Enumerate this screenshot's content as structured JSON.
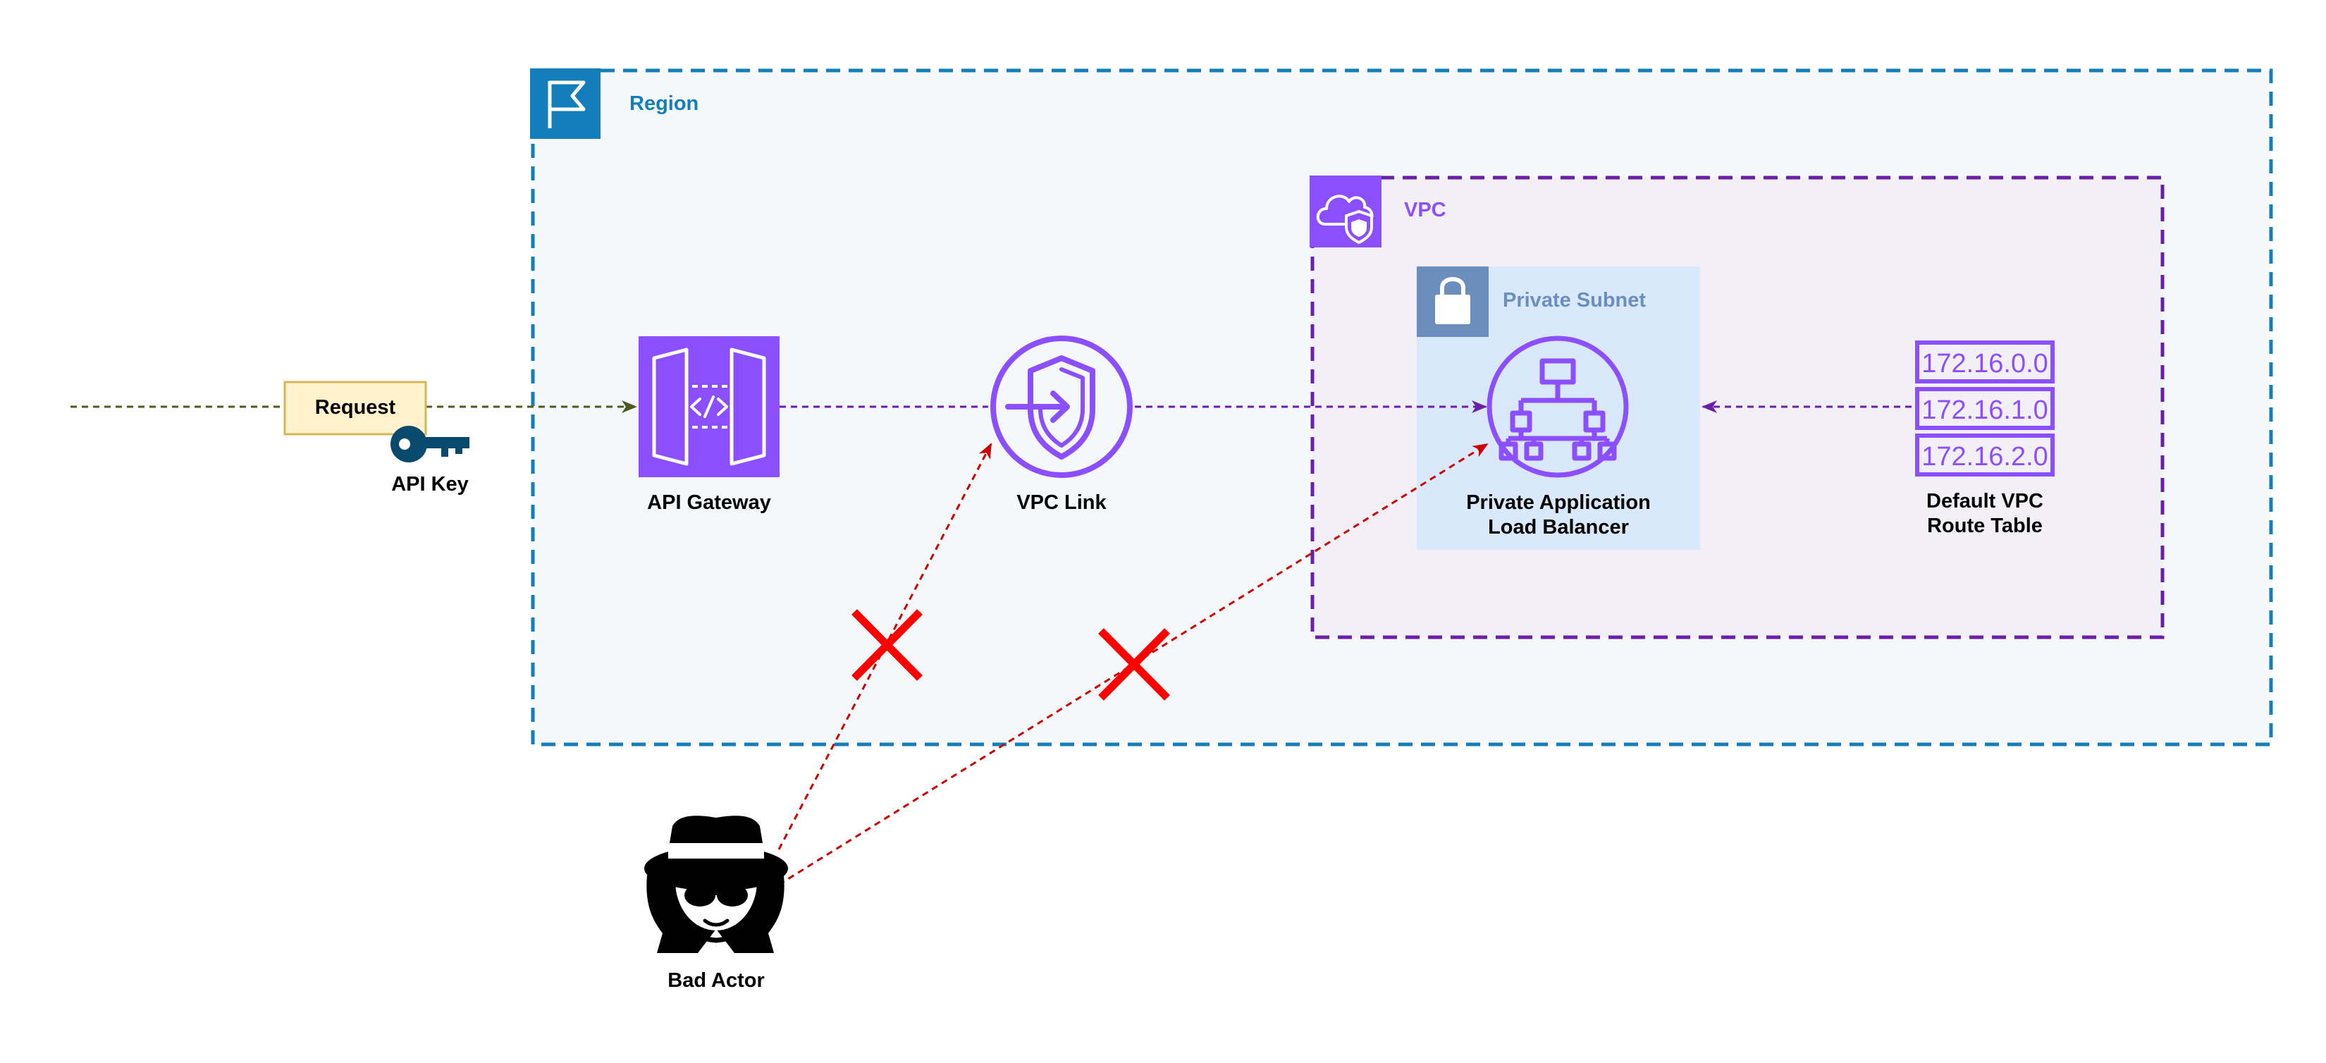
{
  "groups": {
    "region": "Region",
    "vpc": "VPC",
    "subnet": "Private Subnet"
  },
  "nodes": {
    "request": "Request",
    "api_key": "API Key",
    "api_gateway": "API Gateway",
    "vpc_link": "VPC Link",
    "alb": "Private Application\nLoad Balancer",
    "route_table": "Default VPC\nRoute Table",
    "bad_actor": "Bad Actor"
  },
  "routes": [
    "172.16.0.0",
    "172.16.1.0",
    "172.16.2.0"
  ],
  "colors": {
    "region": "#147eba",
    "region_fill": "#f4f8fb",
    "vpc": "#8c4fff",
    "vpc_fill": "#f2f0f6",
    "subnet_fill": "#dae8fc",
    "subnet_icon": "#6c8ebf",
    "subnet_text": "#6c8ebf",
    "request_fill": "#fff2cc",
    "request_stroke": "#d6b656",
    "arrow_olive": "#4d5a1e",
    "arrow_purple": "#6a1fa8",
    "arrow_red": "#cc0000",
    "cross": "#ff0000",
    "key": "#0a4a6e"
  },
  "icons": [
    "flag-icon",
    "vpc-cloud-shield-icon",
    "lock-icon",
    "api-gateway-icon",
    "vpc-link-icon",
    "load-balancer-icon",
    "route-table-icon",
    "key-icon",
    "spy-icon",
    "blocked-cross-icon"
  ]
}
